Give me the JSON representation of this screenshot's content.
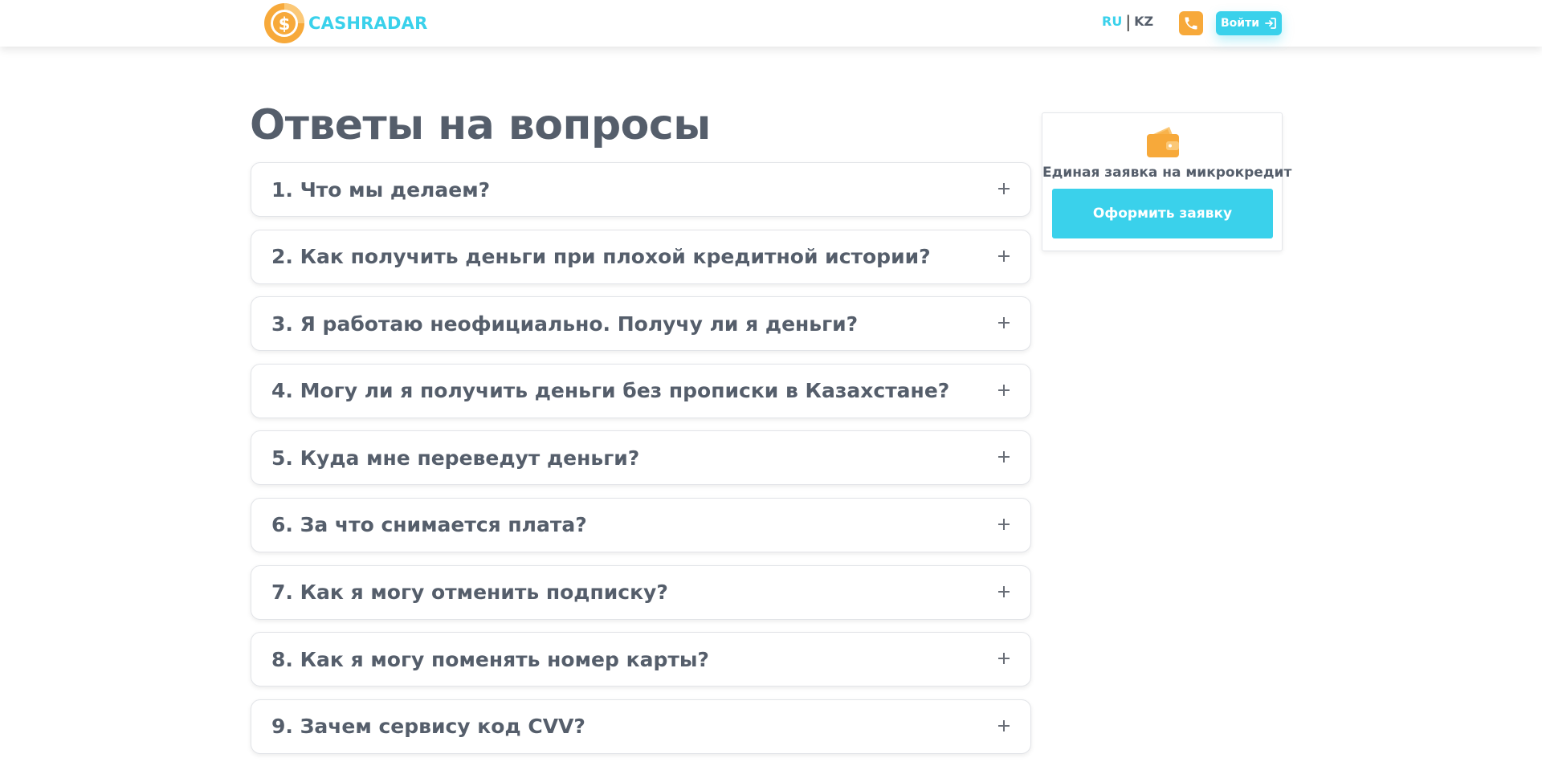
{
  "header": {
    "brand": "CASHRADAR",
    "lang_ru": "RU",
    "lang_separator": "|",
    "lang_kz": "KZ",
    "phone_icon": "phone-icon",
    "login_label": "Войти",
    "login_icon": "sign-in-icon"
  },
  "colors": {
    "accent_cyan": "#3ad1eb",
    "accent_orange": "#f7a93a",
    "text_gray": "#555e6b"
  },
  "main": {
    "title": "Ответы на вопросы",
    "faq": [
      {
        "question": "1. Что мы делаем?"
      },
      {
        "question": "2. Как получить деньги при плохой кредитной истории?"
      },
      {
        "question": "3. Я работаю неофициально. Получу ли я деньги?"
      },
      {
        "question": "4. Могу ли я получить деньги без прописки в Казахстане?"
      },
      {
        "question": "5. Куда мне переведут деньги?"
      },
      {
        "question": "6. За что снимается плата?"
      },
      {
        "question": "7. Как я могу отменить подписку?"
      },
      {
        "question": "8. Как я могу поменять номер карты?"
      },
      {
        "question": "9. Зачем сервису код CVV?"
      }
    ]
  },
  "sidebar": {
    "icon": "wallet-icon",
    "title": "Единая заявка на микрокредит",
    "button_label": "Оформить заявку"
  }
}
